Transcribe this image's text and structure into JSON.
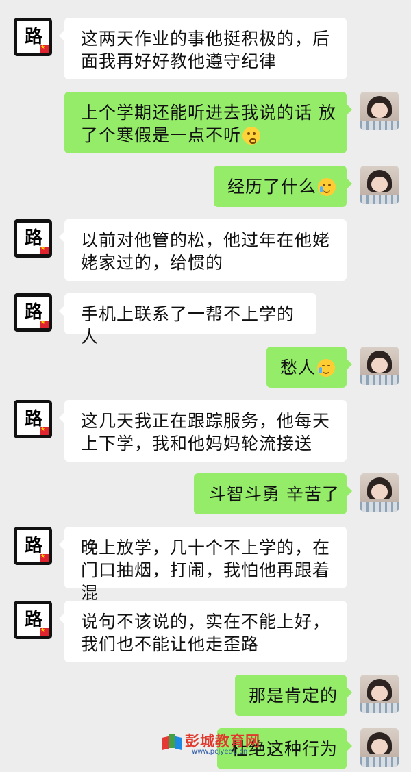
{
  "conversation": {
    "messages": [
      {
        "side": "left",
        "text": "这两天作业的事他挺积极的，后面我再好好教他遵守纪律",
        "emoji": ""
      },
      {
        "side": "right",
        "text": "上个学期还能听进去我说的话 放了个寒假是一点不听",
        "emoji": "flushed-face"
      },
      {
        "side": "right",
        "text": "经历了什么",
        "emoji": "crying-laughing-face"
      },
      {
        "side": "left",
        "text": "以前对他管的松，他过年在他姥姥家过的，给惯的",
        "emoji": ""
      },
      {
        "side": "left",
        "text": "手机上联系了一帮不上学的人",
        "emoji": ""
      },
      {
        "side": "right",
        "text": "愁人",
        "emoji": "crying-laughing-face"
      },
      {
        "side": "left",
        "text": "这几天我正在跟踪服务，他每天上下学，我和他妈妈轮流接送",
        "emoji": ""
      },
      {
        "side": "right",
        "text": "斗智斗勇 辛苦了",
        "emoji": ""
      },
      {
        "side": "left",
        "text": "晚上放学，几十个不上学的，在门口抽烟，打闹，我怕他再跟着混",
        "emoji": ""
      },
      {
        "side": "left",
        "text": "说句不该说的，实在不能上好，我们也不能让他走歪路",
        "emoji": ""
      },
      {
        "side": "right",
        "text": "那是肯定的",
        "emoji": ""
      },
      {
        "side": "right",
        "text": "杜绝这种行为",
        "emoji": ""
      }
    ]
  },
  "avatars": {
    "left_logo_char": "路",
    "left_icon": "road-calligraphy-logo-icon",
    "right_icon": "girl-photo-avatar-icon"
  },
  "watermark": {
    "title": "彭城教育网",
    "url": "www.pcjyedu.cn"
  },
  "colors": {
    "background": "#ededed",
    "incoming_bubble": "#ffffff",
    "outgoing_bubble": "#95ec69"
  }
}
